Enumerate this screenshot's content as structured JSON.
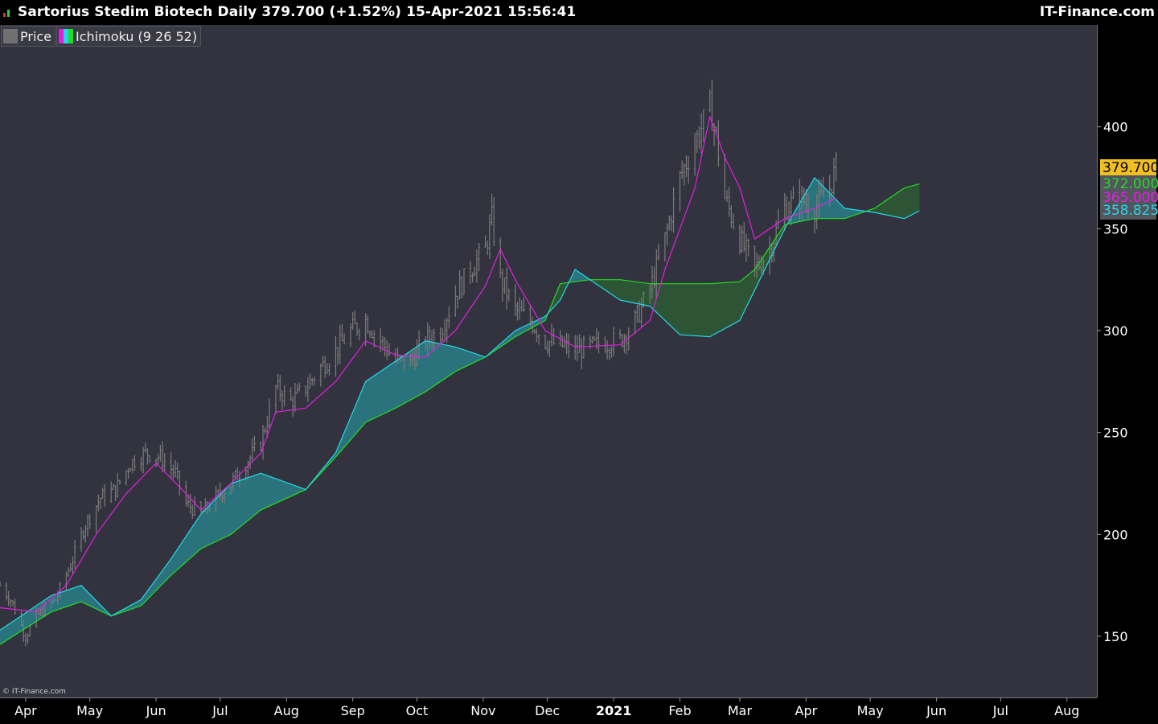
{
  "header": {
    "title": "Sartorius Stedim Biotech Daily 379.700 (+1.52%) 15-Apr-2021 15:56:41",
    "brand": "IT-Finance.com"
  },
  "legend": [
    {
      "label": "Price",
      "icon": "price-swatch-icon"
    },
    {
      "label": "Ichimoku (9 26 52)",
      "icon": "ichimoku-swatch-icon"
    }
  ],
  "copyright": "© IT-Finance.com",
  "colors": {
    "background": "#33333f",
    "price": "#7a7a7a",
    "kijun": "#e020e0",
    "span_a": "#22d8e8",
    "span_b": "#22dd22",
    "last_price_bg": "#f0c020",
    "axis_text": "#ffffff"
  },
  "price_tags": [
    {
      "value": "379.700",
      "y": 379.7,
      "bg": "#f0c020",
      "fg": "#000000"
    },
    {
      "value": "372.000",
      "y": 372.0,
      "bg": "#55555f",
      "fg": "#22dd22"
    },
    {
      "value": "365.000",
      "y": 365.0,
      "bg": "#55555f",
      "fg": "#e020e0"
    },
    {
      "value": "358.825",
      "y": 358.825,
      "bg": "#55555f",
      "fg": "#22d8e8"
    }
  ],
  "chart_data": {
    "type": "ohlc+ichimoku",
    "ylim": [
      120,
      450
    ],
    "y_ticks": [
      150,
      200,
      250,
      300,
      350,
      400
    ],
    "x_range": [
      "2020-03-20",
      "2021-08-15"
    ],
    "months": [
      {
        "label": "Apr",
        "date": "2020-04-01"
      },
      {
        "label": "May",
        "date": "2020-05-01"
      },
      {
        "label": "Jun",
        "date": "2020-06-01"
      },
      {
        "label": "Jul",
        "date": "2020-07-01"
      },
      {
        "label": "Aug",
        "date": "2020-08-01"
      },
      {
        "label": "Sep",
        "date": "2020-09-01"
      },
      {
        "label": "Oct",
        "date": "2020-10-01"
      },
      {
        "label": "Nov",
        "date": "2020-11-01"
      },
      {
        "label": "Dec",
        "date": "2020-12-01"
      },
      {
        "label": "2021",
        "date": "2021-01-01",
        "bold": true
      },
      {
        "label": "Feb",
        "date": "2021-02-01"
      },
      {
        "label": "Mar",
        "date": "2021-03-01"
      },
      {
        "label": "Apr",
        "date": "2021-04-01"
      },
      {
        "label": "May",
        "date": "2021-05-01"
      },
      {
        "label": "Jun",
        "date": "2021-06-01"
      },
      {
        "label": "Jul",
        "date": "2021-07-01"
      },
      {
        "label": "Aug",
        "date": "2021-08-01"
      }
    ],
    "price_anchors": [
      [
        "2020-03-20",
        175
      ],
      [
        "2020-03-25",
        168
      ],
      [
        "2020-04-01",
        150
      ],
      [
        "2020-04-06",
        160
      ],
      [
        "2020-04-15",
        168
      ],
      [
        "2020-04-22",
        185
      ],
      [
        "2020-04-29",
        205
      ],
      [
        "2020-05-06",
        218
      ],
      [
        "2020-05-13",
        222
      ],
      [
        "2020-05-20",
        235
      ],
      [
        "2020-05-27",
        240
      ],
      [
        "2020-06-03",
        238
      ],
      [
        "2020-06-10",
        230
      ],
      [
        "2020-06-15",
        215
      ],
      [
        "2020-06-22",
        210
      ],
      [
        "2020-06-29",
        218
      ],
      [
        "2020-07-06",
        225
      ],
      [
        "2020-07-13",
        235
      ],
      [
        "2020-07-20",
        245
      ],
      [
        "2020-07-27",
        272
      ],
      [
        "2020-08-03",
        265
      ],
      [
        "2020-08-10",
        272
      ],
      [
        "2020-08-17",
        282
      ],
      [
        "2020-08-24",
        290
      ],
      [
        "2020-08-31",
        300
      ],
      [
        "2020-09-07",
        305
      ],
      [
        "2020-09-14",
        295
      ],
      [
        "2020-09-21",
        285
      ],
      [
        "2020-09-28",
        285
      ],
      [
        "2020-10-05",
        295
      ],
      [
        "2020-10-12",
        300
      ],
      [
        "2020-10-19",
        318
      ],
      [
        "2020-10-26",
        330
      ],
      [
        "2020-11-02",
        340
      ],
      [
        "2020-11-05",
        355
      ],
      [
        "2020-11-09",
        325
      ],
      [
        "2020-11-16",
        310
      ],
      [
        "2020-11-23",
        305
      ],
      [
        "2020-11-30",
        295
      ],
      [
        "2020-12-07",
        293
      ],
      [
        "2020-12-14",
        290
      ],
      [
        "2020-12-21",
        292
      ],
      [
        "2020-12-28",
        294
      ],
      [
        "2021-01-04",
        295
      ],
      [
        "2021-01-11",
        305
      ],
      [
        "2021-01-18",
        320
      ],
      [
        "2021-01-25",
        345
      ],
      [
        "2021-02-01",
        375
      ],
      [
        "2021-02-08",
        392
      ],
      [
        "2021-02-15",
        410
      ],
      [
        "2021-02-18",
        395
      ],
      [
        "2021-02-22",
        365
      ],
      [
        "2021-03-01",
        345
      ],
      [
        "2021-03-08",
        330
      ],
      [
        "2021-03-15",
        340
      ],
      [
        "2021-03-22",
        360
      ],
      [
        "2021-03-29",
        365
      ],
      [
        "2021-04-05",
        360
      ],
      [
        "2021-04-12",
        370
      ],
      [
        "2021-04-15",
        379.7
      ]
    ],
    "kijun": [
      [
        "2020-03-20",
        164
      ],
      [
        "2020-04-06",
        162
      ],
      [
        "2020-04-20",
        175
      ],
      [
        "2020-05-04",
        200
      ],
      [
        "2020-05-18",
        220
      ],
      [
        "2020-06-01",
        235
      ],
      [
        "2020-06-15",
        220
      ],
      [
        "2020-06-22",
        212
      ],
      [
        "2020-07-06",
        225
      ],
      [
        "2020-07-20",
        240
      ],
      [
        "2020-07-27",
        260
      ],
      [
        "2020-08-10",
        262
      ],
      [
        "2020-08-24",
        275
      ],
      [
        "2020-09-07",
        295
      ],
      [
        "2020-09-21",
        288
      ],
      [
        "2020-10-05",
        287
      ],
      [
        "2020-10-19",
        300
      ],
      [
        "2020-11-02",
        322
      ],
      [
        "2020-11-09",
        340
      ],
      [
        "2020-11-16",
        325
      ],
      [
        "2020-11-30",
        300
      ],
      [
        "2020-12-14",
        292
      ],
      [
        "2021-01-04",
        293
      ],
      [
        "2021-01-18",
        305
      ],
      [
        "2021-01-25",
        330
      ],
      [
        "2021-02-08",
        370
      ],
      [
        "2021-02-15",
        405
      ],
      [
        "2021-02-22",
        385
      ],
      [
        "2021-03-01",
        370
      ],
      [
        "2021-03-08",
        345
      ],
      [
        "2021-03-22",
        355
      ],
      [
        "2021-04-05",
        360
      ],
      [
        "2021-04-15",
        365
      ]
    ],
    "span_a": [
      [
        "2020-03-20",
        153
      ],
      [
        "2020-04-13",
        170
      ],
      [
        "2020-04-27",
        175
      ],
      [
        "2020-05-11",
        160
      ],
      [
        "2020-05-25",
        168
      ],
      [
        "2020-06-08",
        188
      ],
      [
        "2020-06-22",
        210
      ],
      [
        "2020-07-06",
        225
      ],
      [
        "2020-07-20",
        230
      ],
      [
        "2020-08-10",
        222
      ],
      [
        "2020-08-24",
        240
      ],
      [
        "2020-09-07",
        275
      ],
      [
        "2020-09-21",
        285
      ],
      [
        "2020-10-05",
        295
      ],
      [
        "2020-10-19",
        292
      ],
      [
        "2020-11-02",
        287
      ],
      [
        "2020-11-16",
        300
      ],
      [
        "2020-11-30",
        307
      ],
      [
        "2020-12-07",
        315
      ],
      [
        "2020-12-14",
        330
      ],
      [
        "2020-12-21",
        325
      ],
      [
        "2021-01-04",
        315
      ],
      [
        "2021-01-18",
        312
      ],
      [
        "2021-02-01",
        298
      ],
      [
        "2021-02-15",
        297
      ],
      [
        "2021-03-01",
        305
      ],
      [
        "2021-03-08",
        320
      ],
      [
        "2021-03-22",
        350
      ],
      [
        "2021-04-05",
        375
      ],
      [
        "2021-04-19",
        360
      ],
      [
        "2021-05-03",
        358
      ],
      [
        "2021-05-17",
        355
      ],
      [
        "2021-05-24",
        358.825
      ]
    ],
    "span_b": [
      [
        "2020-03-20",
        146
      ],
      [
        "2020-04-13",
        162
      ],
      [
        "2020-04-27",
        167
      ],
      [
        "2020-05-11",
        160
      ],
      [
        "2020-05-25",
        165
      ],
      [
        "2020-06-08",
        180
      ],
      [
        "2020-06-22",
        193
      ],
      [
        "2020-07-06",
        200
      ],
      [
        "2020-07-20",
        212
      ],
      [
        "2020-08-10",
        222
      ],
      [
        "2020-08-24",
        238
      ],
      [
        "2020-09-07",
        255
      ],
      [
        "2020-09-21",
        262
      ],
      [
        "2020-10-05",
        270
      ],
      [
        "2020-10-19",
        280
      ],
      [
        "2020-11-02",
        287
      ],
      [
        "2020-11-16",
        297
      ],
      [
        "2020-11-30",
        305
      ],
      [
        "2020-12-07",
        323
      ],
      [
        "2020-12-21",
        325
      ],
      [
        "2021-01-04",
        325
      ],
      [
        "2021-01-18",
        323
      ],
      [
        "2021-02-01",
        323
      ],
      [
        "2021-02-15",
        323
      ],
      [
        "2021-03-01",
        324
      ],
      [
        "2021-03-08",
        330
      ],
      [
        "2021-03-22",
        352
      ],
      [
        "2021-04-05",
        355
      ],
      [
        "2021-04-19",
        355
      ],
      [
        "2021-05-03",
        360
      ],
      [
        "2021-05-17",
        370
      ],
      [
        "2021-05-24",
        372
      ]
    ]
  }
}
